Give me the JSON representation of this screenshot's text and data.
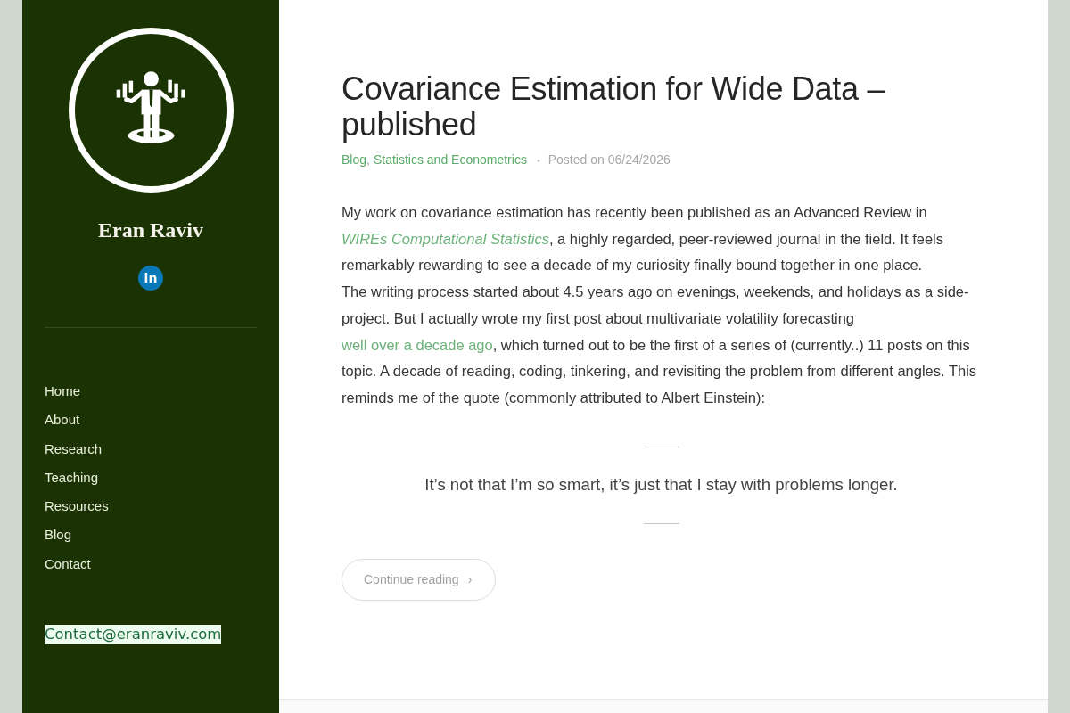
{
  "sidebar": {
    "site_title": "Eran Raviv",
    "social": [
      {
        "label": "in"
      }
    ],
    "nav": [
      {
        "label": "Home"
      },
      {
        "label": "About"
      },
      {
        "label": "Research"
      },
      {
        "label": "Teaching"
      },
      {
        "label": "Resources"
      },
      {
        "label": "Blog"
      },
      {
        "label": "Contact"
      }
    ],
    "email": "Contact@eranraviv.com"
  },
  "post": {
    "title": "Covariance Estimation for Wide Data – published",
    "categories": [
      "Blog",
      "Statistics and Econometrics"
    ],
    "category_separator": ",",
    "meta_separator": "•",
    "posted": "Posted on 06/24/2026",
    "paragraphs": [
      {
        "segments": [
          {
            "kind": "text",
            "text": "My work on covariance estimation has recently been published as an Advanced Review in "
          },
          {
            "kind": "citation",
            "text": "WIREs Computational Statistics"
          },
          {
            "kind": "text",
            "text": ", a highly regarded, peer-reviewed journal in the field. It feels remarkably rewarding to see a decade of my curiosity finally bound together in one place."
          }
        ]
      },
      {
        "segments": [
          {
            "kind": "text",
            "text": "The writing process started about 4.5 years ago on evenings, weekends, and holidays as a side-project. But I actually wrote my first post about multivariate volatility forecasting "
          },
          {
            "kind": "link",
            "text": "well over a decade ago"
          },
          {
            "kind": "text",
            "text": ", which turned out to be the first of a series of (currently..) 11 posts on this topic. A decade of reading, coding, tinkering, and revisiting the problem from different angles. This reminds me of the quote (commonly attributed to Albert Einstein):"
          }
        ]
      }
    ],
    "quote": "It’s not that I’m so smart, it’s just that I stay with problems longer.",
    "more_button": {
      "label": "Continue reading",
      "icon": "›"
    }
  }
}
